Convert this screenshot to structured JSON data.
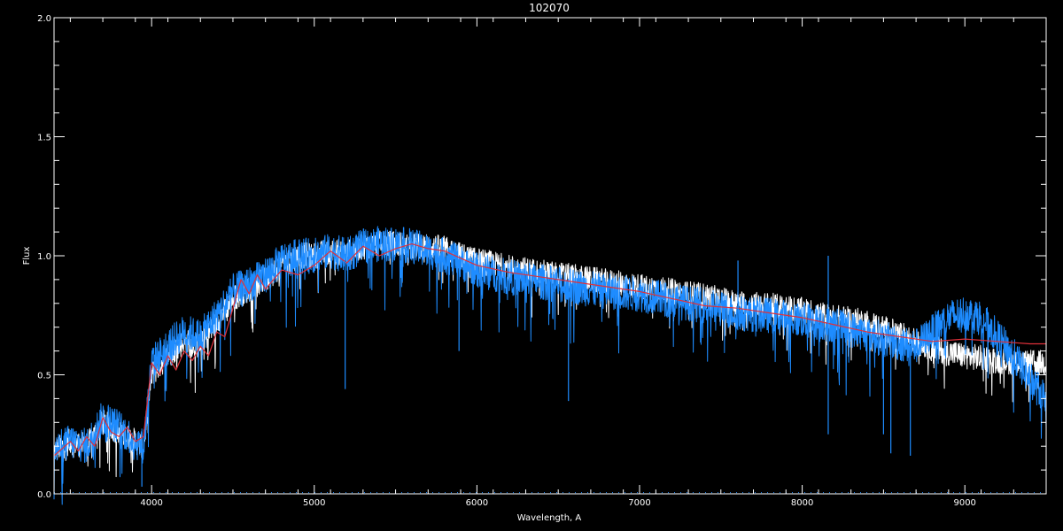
{
  "chart_data": {
    "type": "line",
    "title": "102070",
    "xlabel": "Wavelength, A",
    "ylabel": "Flux",
    "xlim": [
      3400,
      9500
    ],
    "ylim": [
      0.0,
      2.0
    ],
    "x_ticks": [
      4000,
      5000,
      6000,
      7000,
      8000,
      9000
    ],
    "x_tick_labels": [
      "4000",
      "5000",
      "6000",
      "7000",
      "8000",
      "9000"
    ],
    "y_ticks": [
      0.0,
      0.5,
      1.0,
      1.5,
      2.0
    ],
    "y_tick_labels": [
      "0.0",
      "0.5",
      "1.0",
      "1.5",
      "2.0"
    ],
    "grid": false,
    "background": "#000000",
    "axis_color": "#ffffff",
    "series": [
      {
        "color": "#ffffff",
        "noise": 0.055,
        "x": [
          3400,
          3500,
          3600,
          3700,
          3800,
          3900,
          3950,
          4000,
          4100,
          4200,
          4300,
          4400,
          4500,
          4600,
          4700,
          4800,
          4900,
          5000,
          5100,
          5200,
          5300,
          5400,
          5500,
          5600,
          5700,
          5800,
          5900,
          6000,
          6200,
          6400,
          6600,
          6800,
          7000,
          7200,
          7400,
          7600,
          7800,
          8000,
          8200,
          8400,
          8600,
          8800,
          9000,
          9200,
          9400,
          9500
        ],
        "y": [
          0.18,
          0.22,
          0.2,
          0.3,
          0.26,
          0.22,
          0.2,
          0.5,
          0.58,
          0.64,
          0.62,
          0.72,
          0.82,
          0.86,
          0.9,
          0.96,
          1.0,
          1.0,
          1.02,
          1.01,
          1.04,
          1.05,
          1.05,
          1.04,
          1.04,
          1.03,
          1.0,
          0.98,
          0.95,
          0.93,
          0.91,
          0.89,
          0.87,
          0.85,
          0.83,
          0.8,
          0.79,
          0.77,
          0.74,
          0.72,
          0.67,
          0.61,
          0.58,
          0.56,
          0.55,
          0.55
        ]
      },
      {
        "color": "#1e8cff",
        "noise": 0.075,
        "x": [
          3400,
          3500,
          3600,
          3700,
          3800,
          3900,
          3950,
          4000,
          4100,
          4200,
          4300,
          4400,
          4500,
          4600,
          4700,
          4800,
          4900,
          5000,
          5100,
          5200,
          5300,
          5400,
          5500,
          5600,
          5700,
          5800,
          5900,
          6000,
          6200,
          6400,
          6600,
          6800,
          7000,
          7200,
          7400,
          7600,
          7800,
          8000,
          8200,
          8400,
          8600,
          8700,
          8800,
          8900,
          9000,
          9100,
          9200,
          9300,
          9400,
          9500
        ],
        "y": [
          0.18,
          0.22,
          0.2,
          0.32,
          0.28,
          0.22,
          0.2,
          0.55,
          0.62,
          0.68,
          0.66,
          0.75,
          0.85,
          0.88,
          0.92,
          0.98,
          1.0,
          1.0,
          1.02,
          1.0,
          1.04,
          1.05,
          1.05,
          1.04,
          1.02,
          1.0,
          0.97,
          0.94,
          0.91,
          0.89,
          0.87,
          0.85,
          0.84,
          0.81,
          0.79,
          0.76,
          0.75,
          0.73,
          0.71,
          0.67,
          0.63,
          0.62,
          0.68,
          0.74,
          0.76,
          0.74,
          0.66,
          0.58,
          0.48,
          0.4
        ]
      },
      {
        "color": "#e0303a",
        "noise": 0.0,
        "x": [
          3400,
          3500,
          3550,
          3600,
          3650,
          3700,
          3750,
          3800,
          3850,
          3900,
          3950,
          4000,
          4050,
          4100,
          4150,
          4200,
          4250,
          4300,
          4350,
          4400,
          4450,
          4500,
          4550,
          4600,
          4650,
          4700,
          4800,
          4900,
          5000,
          5100,
          5200,
          5300,
          5400,
          5500,
          5600,
          5700,
          5800,
          5900,
          6000,
          6200,
          6400,
          6600,
          6800,
          7000,
          7200,
          7400,
          7600,
          7800,
          8000,
          8200,
          8400,
          8600,
          8800,
          9000,
          9200,
          9400,
          9500
        ],
        "y": [
          0.16,
          0.22,
          0.18,
          0.24,
          0.2,
          0.32,
          0.26,
          0.24,
          0.28,
          0.22,
          0.24,
          0.55,
          0.5,
          0.58,
          0.52,
          0.6,
          0.56,
          0.62,
          0.58,
          0.68,
          0.66,
          0.78,
          0.9,
          0.84,
          0.92,
          0.86,
          0.94,
          0.92,
          0.96,
          1.02,
          0.97,
          1.04,
          1.0,
          1.03,
          1.05,
          1.03,
          1.02,
          0.99,
          0.96,
          0.93,
          0.91,
          0.89,
          0.87,
          0.85,
          0.82,
          0.79,
          0.78,
          0.76,
          0.74,
          0.71,
          0.68,
          0.66,
          0.64,
          0.65,
          0.64,
          0.63,
          0.63
        ]
      }
    ],
    "spikes": [
      {
        "x": 3940,
        "y": 0.03
      },
      {
        "x": 5190,
        "y": 0.44
      },
      {
        "x": 5890,
        "y": 0.6
      },
      {
        "x": 6563,
        "y": 0.39
      },
      {
        "x": 7605,
        "y": 0.98
      },
      {
        "x": 8160,
        "y": 1.0
      },
      {
        "x": 8160,
        "y": 0.25
      },
      {
        "x": 8500,
        "y": 0.25
      },
      {
        "x": 8545,
        "y": 0.17
      },
      {
        "x": 8665,
        "y": 0.16
      }
    ]
  }
}
